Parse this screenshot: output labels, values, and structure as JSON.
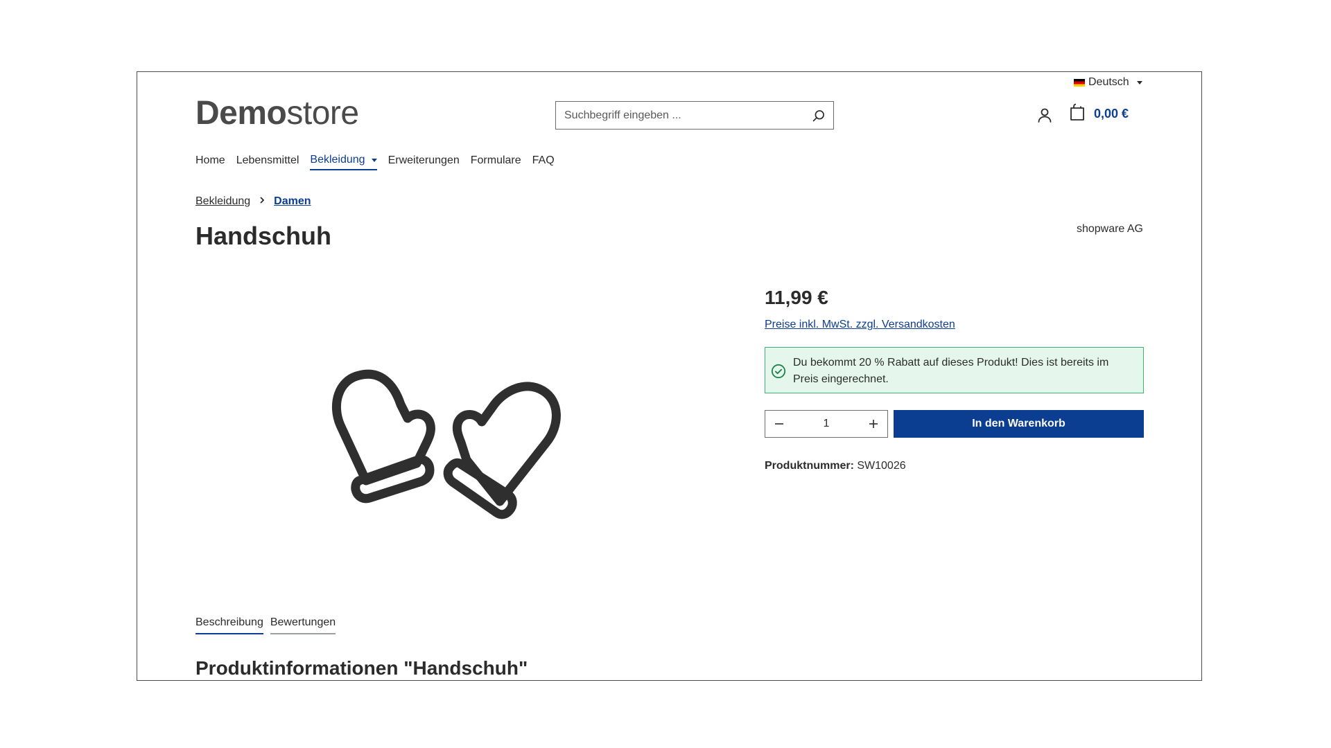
{
  "header": {
    "language": "Deutsch",
    "logo": {
      "bold": "Demo",
      "light": "store"
    },
    "search_placeholder": "Suchbegriff eingeben ...",
    "cart_total": "0,00 €"
  },
  "nav": {
    "items": [
      {
        "label": "Home"
      },
      {
        "label": "Lebensmittel"
      },
      {
        "label": "Bekleidung"
      },
      {
        "label": "Erweiterungen"
      },
      {
        "label": "Formulare"
      },
      {
        "label": "FAQ"
      }
    ],
    "active": "Bekleidung"
  },
  "breadcrumb": [
    "Bekleidung",
    "Damen"
  ],
  "product": {
    "title": "Handschuh",
    "manufacturer": "shopware AG",
    "price": "11,99 €",
    "tax_note": "Preise inkl. MwSt. zzgl. Versandkosten",
    "discount_text": "Du bekommt 20 % Rabatt auf dieses Produkt! Dies ist bereits im Preis eingerechnet.",
    "quantity": "1",
    "buy_label": "In den Warenkorb",
    "number_label": "Produktnummer:",
    "number_value": "SW10026"
  },
  "tabs": [
    "Beschreibung",
    "Bewertungen"
  ],
  "section_title": "Produktinformationen \"Handschuh\"",
  "colors": {
    "primary": "#0b3d91",
    "success_bg": "#e5f7ed",
    "success_border": "#3cb371"
  }
}
